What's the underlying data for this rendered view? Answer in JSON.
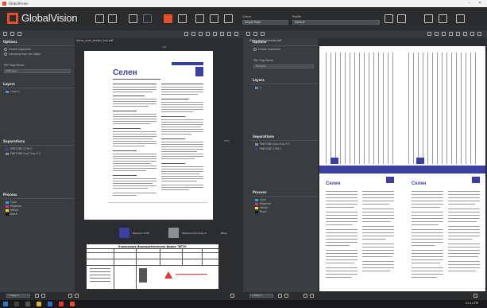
{
  "titlebar": {
    "app": "GlobalVision",
    "minimize": "–",
    "maximize": "□",
    "close": "✕"
  },
  "toolbar": {
    "logo": "GlobalVision",
    "combo1_label": "Colour",
    "combo1_value": "Single Page",
    "combo2_label": "Profile",
    "combo2_value": "Default"
  },
  "left": {
    "filename": "Selva_ener_maker_tub.pdf",
    "options_title": "Options",
    "opt1": "Enable Inspection",
    "opt2": "Following layer for region",
    "pdf_pages_label": "PDF Page Boxes",
    "pdf_pages_value": "Trim box",
    "layers_title": "Layers",
    "layer1": "Layer 1",
    "separations_title": "Separations",
    "sep1": "PANTONE 2736 C",
    "sep2": "PANTONE Cool Gray 9 C",
    "process_title": "Process",
    "process": [
      "Cyan",
      "Magenta",
      "Yellow",
      "Black"
    ],
    "page_label": "1/4",
    "zoom": "25%",
    "brand": "Селен",
    "swatch1": "Pantone 2736",
    "swatch2": "Pantone Cool Gray 9",
    "swatch3": "Black",
    "table_title": "Корпорация фармацевтическая фирма \"ВЕТА\""
  },
  "right": {
    "filename": "Selva_ener_foldout.pdf",
    "options_title": "Options",
    "opt1": "Enable Inspection",
    "pdf_pages_label": "PDF Page Boxes",
    "pdf_pages_value": "Trim box",
    "layers_title": "Layers",
    "layer1": "1",
    "separations_title": "Separations",
    "sep1": "PANTONE Cool Gray 9 C",
    "sep2": "PANTONE 2736 C",
    "process_title": "Process",
    "process": [
      "Cyan",
      "Magenta",
      "Yellow",
      "Black"
    ],
    "brand_left": "Селен",
    "brand_right": "Селен"
  },
  "bottom": {
    "left_page": "1 Page 1",
    "right_page": "1 Page 1"
  },
  "taskbar": {
    "time": "12:14 PM"
  },
  "colors": {
    "accent": "#e8502b",
    "bg": "#3a3d40",
    "toolbar": "#2a2c2e",
    "purple": "#3a3fa0"
  }
}
